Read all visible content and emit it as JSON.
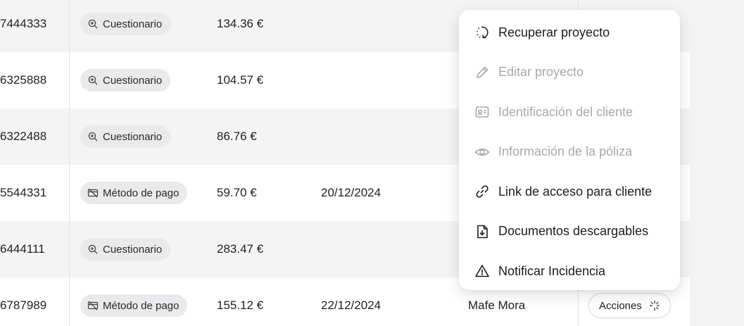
{
  "rows": [
    {
      "id": "7444333",
      "status": "Cuestionario",
      "status_icon": "zoom-icon",
      "price": "134.36 €",
      "date": "",
      "agent": ""
    },
    {
      "id": "6325888",
      "status": "Cuestionario",
      "status_icon": "zoom-icon",
      "price": "104.57 €",
      "date": "",
      "agent": ""
    },
    {
      "id": "6322488",
      "status": "Cuestionario",
      "status_icon": "zoom-icon",
      "price": "86.76 €",
      "date": "",
      "agent": ""
    },
    {
      "id": "5544331",
      "status": "Método de pago",
      "status_icon": "card-off-icon",
      "price": "59.70 €",
      "date": "20/12/2024",
      "agent": ""
    },
    {
      "id": "6444111",
      "status": "Cuestionario",
      "status_icon": "zoom-icon",
      "price": "283.47 €",
      "date": "",
      "agent": ""
    },
    {
      "id": "6787989",
      "status": "Método de pago",
      "status_icon": "card-off-icon",
      "price": "155.12 €",
      "date": "22/12/2024",
      "agent": "Mafe Mora"
    }
  ],
  "actions_label": "Acciones",
  "menu": {
    "items": [
      {
        "label": "Recuperar proyecto",
        "icon": "refresh-dotted-icon",
        "enabled": true
      },
      {
        "label": "Editar proyecto",
        "icon": "pencil-icon",
        "enabled": false
      },
      {
        "label": "Identificación del cliente",
        "icon": "id-card-icon",
        "enabled": false
      },
      {
        "label": "Información de la póliza",
        "icon": "eye-icon",
        "enabled": false
      },
      {
        "label": "Link de acceso para cliente",
        "icon": "link-icon",
        "enabled": true
      },
      {
        "label": "Documentos descargables",
        "icon": "file-download-icon",
        "enabled": true
      },
      {
        "label": "Notificar Incidencia",
        "icon": "alert-triangle-icon",
        "enabled": true
      }
    ]
  },
  "colors": {
    "row_alt": "#f4f4f5",
    "pill_bg": "#eaeaec",
    "disabled_text": "#a8a8aa"
  }
}
